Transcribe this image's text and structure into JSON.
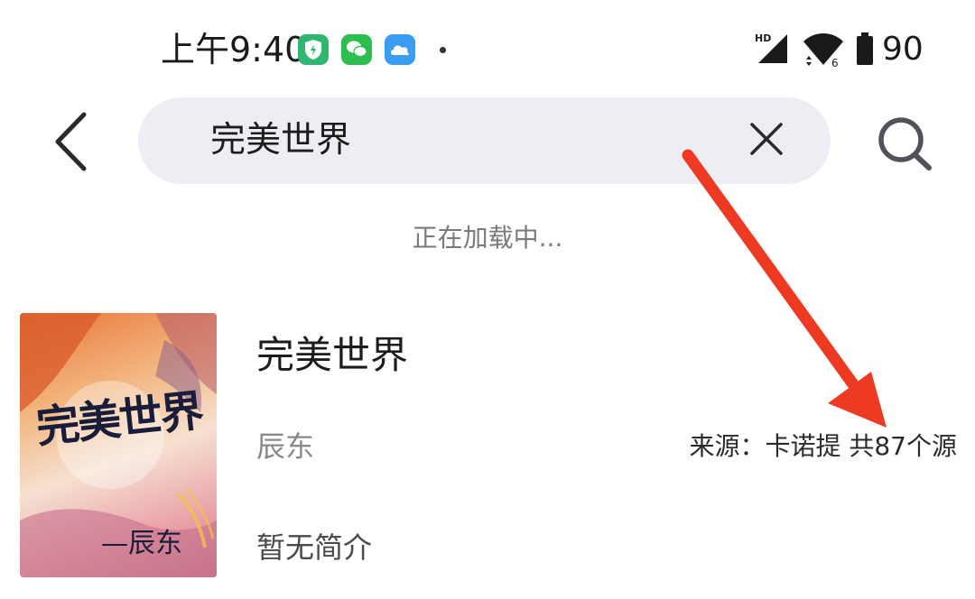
{
  "status_bar": {
    "time": "上午9:40",
    "battery_level": "90",
    "icons": [
      "shield-app-icon",
      "wechat-icon",
      "cloud-app-icon",
      "notification-dot",
      "hd-signal-icon",
      "wifi-icon",
      "battery-icon"
    ]
  },
  "search": {
    "query": "完美世界",
    "loading_text": "正在加载中..."
  },
  "results": [
    {
      "title": "完美世界",
      "author": "辰东",
      "source": "来源：卡诺提 共87个源",
      "intro": "暂无简介",
      "cover_title": "完美世界",
      "cover_author": "—辰东"
    }
  ],
  "colors": {
    "search_background": "#eceef3",
    "annotation_arrow": "#ee3a22"
  }
}
